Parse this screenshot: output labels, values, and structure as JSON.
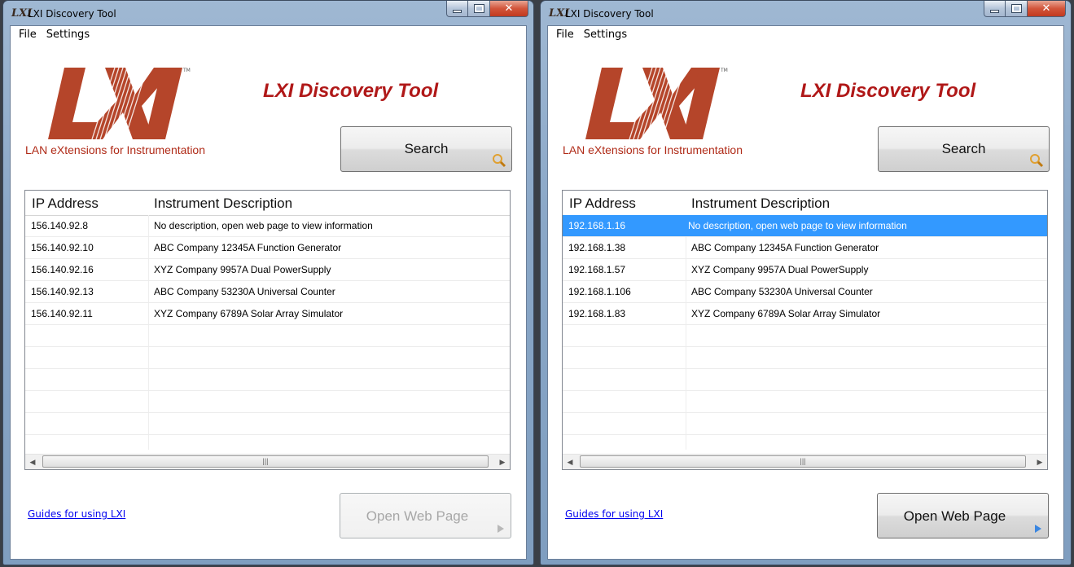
{
  "colors": {
    "brand_red": "#b01818",
    "logo_red": "#b5452a",
    "selection": "#3399ff",
    "link": "#0000ee"
  },
  "windows": [
    {
      "title_logo": "LXI",
      "title": "LXI Discovery Tool",
      "menu": [
        "File",
        "Settings"
      ],
      "logo_text": "LXI",
      "tagline": "LAN eXtensions for Instrumentation",
      "app_title": "LXI Discovery Tool",
      "search_label": "Search",
      "columns": [
        "IP Address",
        "Instrument Description"
      ],
      "rows": [
        {
          "ip": "156.140.92.8",
          "desc": "No description, open web page to view information"
        },
        {
          "ip": "156.140.92.10",
          "desc": "ABC Company 12345A Function Generator"
        },
        {
          "ip": "156.140.92.16",
          "desc": "XYZ Company 9957A Dual PowerSupply"
        },
        {
          "ip": "156.140.92.13",
          "desc": "ABC Company 53230A Universal Counter"
        },
        {
          "ip": "156.140.92.11",
          "desc": "XYZ Company 6789A Solar Array Simulator"
        }
      ],
      "selected_row": null,
      "guides_link": "Guides for using LXI",
      "open_label": "Open Web Page",
      "open_enabled": false
    },
    {
      "title_logo": "LXI",
      "title": "LXI Discovery Tool",
      "menu": [
        "File",
        "Settings"
      ],
      "logo_text": "LXI",
      "tagline": "LAN eXtensions for Instrumentation",
      "app_title": "LXI Discovery Tool",
      "search_label": "Search",
      "columns": [
        "IP Address",
        "Instrument Description"
      ],
      "rows": [
        {
          "ip": "192.168.1.16",
          "desc": "No description, open web page to view information"
        },
        {
          "ip": "192.168.1.38",
          "desc": "ABC Company 12345A Function Generator"
        },
        {
          "ip": "192.168.1.57",
          "desc": "XYZ Company 9957A Dual PowerSupply"
        },
        {
          "ip": "192.168.1.106",
          "desc": "ABC Company 53230A Universal Counter"
        },
        {
          "ip": "192.168.1.83",
          "desc": "XYZ Company 6789A Solar Array Simulator"
        }
      ],
      "selected_row": 0,
      "guides_link": "Guides for using LXI",
      "open_label": "Open Web Page",
      "open_enabled": true
    }
  ]
}
